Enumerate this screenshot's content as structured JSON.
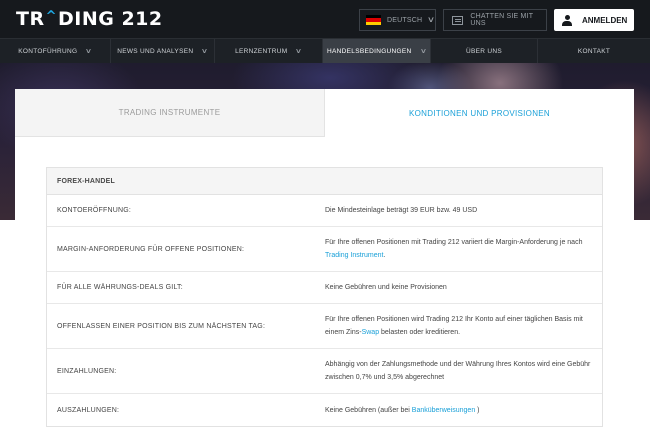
{
  "header": {
    "logo": {
      "pre": "TR",
      "caret": "^",
      "post": "DING 212"
    },
    "language_label": "DEUTSCH",
    "chat_label": "CHATTEN SIE MIT UNS",
    "login_label": "ANMELDEN",
    "flag_colors": [
      "#000000",
      "#dd0000",
      "#ffce00"
    ]
  },
  "nav": {
    "items": [
      {
        "label": "KONTOFÜHRUNG",
        "chevron": true
      },
      {
        "label": "NEWS UND ANALYSEN",
        "chevron": true
      },
      {
        "label": "LERNZENTRUM",
        "chevron": true
      },
      {
        "label": "HANDELSBEDINGUNGEN",
        "chevron": true
      },
      {
        "label": "ÜBER UNS",
        "chevron": false
      },
      {
        "label": "KONTAKT",
        "chevron": false
      }
    ]
  },
  "tabs": {
    "instruments": "TRADING INSTRUMENTE",
    "conditions": "KONDITIONEN UND PROVISIONEN"
  },
  "table": {
    "heading": "FOREX-HANDEL",
    "rows": [
      {
        "label": "KONTOERÖFFNUNG:",
        "value_parts": [
          {
            "text": "Die Mindesteinlage beträgt 39 EUR bzw. 49 USD"
          }
        ]
      },
      {
        "label": "MARGIN-ANFORDERUNG FÜR OFFENE POSITIONEN:",
        "value_parts": [
          {
            "text": "Für Ihre offenen Positionen mit Trading 212 variiert die Margin-Anforderung je nach "
          },
          {
            "text": "Trading Instrument",
            "link": true
          },
          {
            "text": "."
          }
        ]
      },
      {
        "label": "FÜR ALLE WÄHRUNGS-DEALS GILT:",
        "value_parts": [
          {
            "text": "Keine Gebühren und keine Provisionen"
          }
        ]
      },
      {
        "label": "OFFENLASSEN EINER POSITION BIS ZUM NÄCHSTEN TAG:",
        "value_parts": [
          {
            "text": "Für Ihre offenen Positionen wird Trading 212 Ihr Konto auf einer täglichen Basis mit einem Zins-"
          },
          {
            "text": "Swap",
            "link": true
          },
          {
            "text": " belasten oder kreditieren."
          }
        ]
      },
      {
        "label": "EINZAHLUNGEN:",
        "value_parts": [
          {
            "text": "Abhängig von der Zahlungsmethode und der Währung Ihres Kontos wird eine Gebühr zwischen 0,7% und 3,5% abgerechnet"
          }
        ]
      },
      {
        "label": "AUSZAHLUNGEN:",
        "value_parts": [
          {
            "text": "Keine Gebühren (außer bei "
          },
          {
            "text": "Banküberweisungen",
            "link": true
          },
          {
            "text": " )"
          }
        ]
      }
    ]
  }
}
